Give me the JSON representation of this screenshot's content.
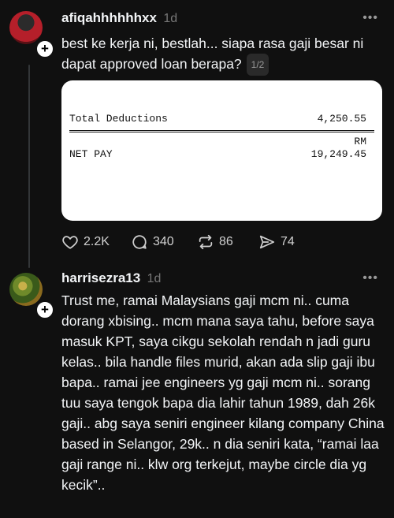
{
  "posts": [
    {
      "username": "afiqahhhhhhxx",
      "time": "1d",
      "more": "•••",
      "text": "best ke kerja ni, bestlah... siapa rasa gaji besar ni dapat approved loan berapa?",
      "pager": "1/2",
      "attachment": {
        "deductions_label": "Total Deductions",
        "deductions_value": "4,250.55",
        "currency": "RM",
        "netpay_label": "NET PAY",
        "netpay_value": "19,249.45"
      },
      "actions": {
        "likes": "2.2K",
        "replies": "340",
        "reposts": "86",
        "shares": "74"
      }
    },
    {
      "username": "harrisezra13",
      "time": "1d",
      "more": "•••",
      "text": "Trust me, ramai Malaysians gaji mcm ni.. cuma dorang xbising.. mcm mana saya tahu, before saya masuk KPT, saya cikgu sekolah rendah n jadi guru kelas.. bila handle files murid, akan ada slip gaji ibu bapa.. ramai jee engineers yg gaji mcm ni.. sorang tuu saya tengok bapa dia lahir tahun 1989, dah 26k gaji.. abg saya seniri engineer kilang company China based in Selangor, 29k.. n dia seniri kata, “ramai laa gaji range ni.. klw org terkejut, maybe circle dia yg kecik”.."
    }
  ],
  "icons": {
    "plus": "+"
  }
}
